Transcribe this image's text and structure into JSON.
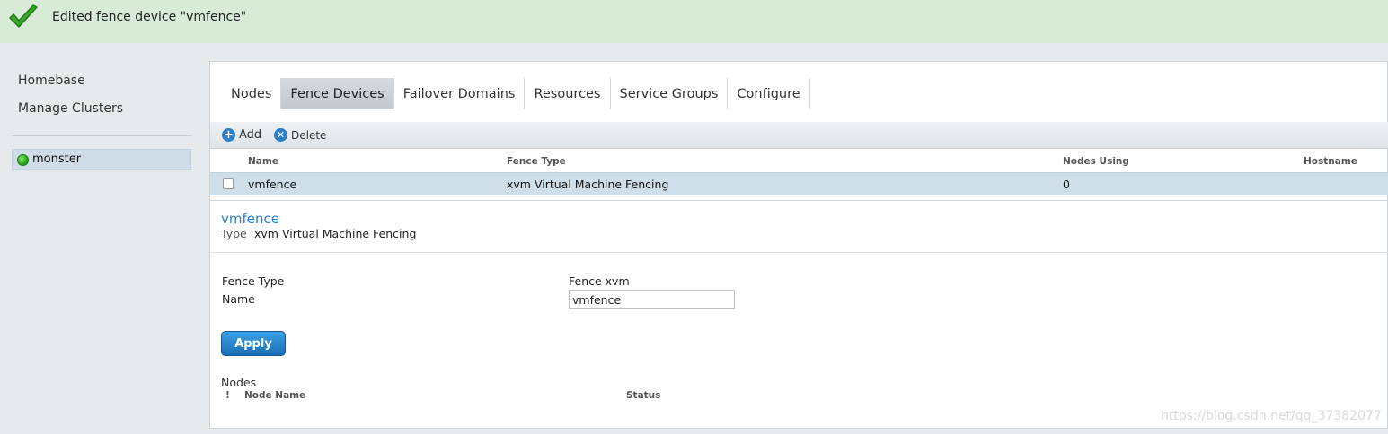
{
  "notification": {
    "icon": "check-icon",
    "message": "Edited fence device \"vmfence\""
  },
  "sidebar": {
    "links": [
      {
        "label": "Homebase"
      },
      {
        "label": "Manage Clusters"
      }
    ],
    "clusters": [
      {
        "label": "monster",
        "status_color": "#2db81d"
      }
    ]
  },
  "tabs": [
    {
      "label": "Nodes",
      "active": false
    },
    {
      "label": "Fence Devices",
      "active": true
    },
    {
      "label": "Failover Domains",
      "active": false
    },
    {
      "label": "Resources",
      "active": false
    },
    {
      "label": "Service Groups",
      "active": false
    },
    {
      "label": "Configure",
      "active": false
    }
  ],
  "toolbar": {
    "add_label": "Add",
    "delete_label": "Delete"
  },
  "table": {
    "columns": [
      "Name",
      "Fence Type",
      "Nodes Using",
      "Hostname"
    ],
    "rows": [
      {
        "name": "vmfence",
        "fence_type": "xvm Virtual Machine Fencing",
        "nodes_using": "0",
        "hostname": ""
      }
    ]
  },
  "detail": {
    "title": "vmfence",
    "type_label": "Type",
    "type_value": "xvm Virtual Machine Fencing",
    "form": {
      "fence_type_label": "Fence Type",
      "fence_type_value": "Fence xvm",
      "name_label": "Name",
      "name_value": "vmfence"
    },
    "apply_label": "Apply",
    "nodes_section": {
      "label": "Nodes",
      "col_flag": "!",
      "col_node_name": "Node Name",
      "col_status": "Status"
    }
  },
  "watermark": "https://blog.csdn.net/qq_37382077",
  "colors": {
    "notification_bg": "#d8ebd7",
    "accent": "#2a7fc7",
    "selected_row": "#cfdfe9"
  }
}
